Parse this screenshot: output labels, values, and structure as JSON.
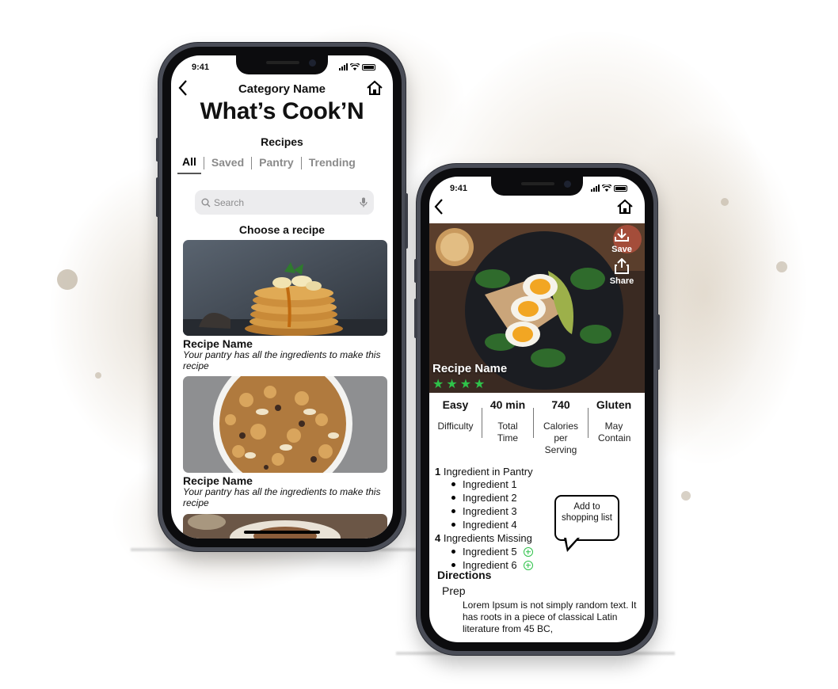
{
  "phone_left": {
    "status": {
      "time": "9:41"
    },
    "header": {
      "category": "Category Name",
      "app_title": "What’s Cook’N",
      "section_title": "Recipes"
    },
    "tabs": [
      {
        "label": "All",
        "active": true
      },
      {
        "label": "Saved",
        "active": false
      },
      {
        "label": "Pantry",
        "active": false
      },
      {
        "label": "Trending",
        "active": false
      }
    ],
    "search": {
      "placeholder": "Search"
    },
    "choose_label": "Choose a recipe",
    "recipes": [
      {
        "name": "Recipe Name",
        "description": "Your pantry has all the ingredients to make this recipe",
        "image": "pancake-stack"
      },
      {
        "name": "Recipe Name",
        "description": "Your pantry has all the ingredients to make this recipe",
        "image": "granola-bowl"
      }
    ]
  },
  "phone_right": {
    "status": {
      "time": "9:41"
    },
    "hero": {
      "recipe_name": "Recipe Name",
      "rating_stars": 4,
      "save_label": "Save",
      "share_label": "Share",
      "image": "egg-avocado-toast"
    },
    "stats": [
      {
        "value": "Easy",
        "label": "Difficulty"
      },
      {
        "value": "40 min",
        "label": "Total Time"
      },
      {
        "value": "740",
        "label": "Calories per Serving"
      },
      {
        "value": "Gluten",
        "label": "May Contain"
      }
    ],
    "pantry": {
      "count": "1",
      "heading": "Ingredient in Pantry",
      "items": [
        "Ingredient 1",
        "Ingredient 2",
        "Ingredient 3",
        "Ingredient 4"
      ]
    },
    "missing": {
      "count": "4",
      "heading": "Ingredients Missing",
      "items": [
        "Ingredient 5",
        "Ingredient 6"
      ]
    },
    "callout": "Add to shopping list",
    "directions": {
      "title": "Directions",
      "step_title": "Prep",
      "text": "Lorem Ipsum is not simply random text. It has roots in a piece of classical Latin literature from 45 BC,"
    }
  },
  "colors": {
    "star": "#2fc24a",
    "add_icon": "#2fc24a",
    "frame": "#4a4d57"
  }
}
